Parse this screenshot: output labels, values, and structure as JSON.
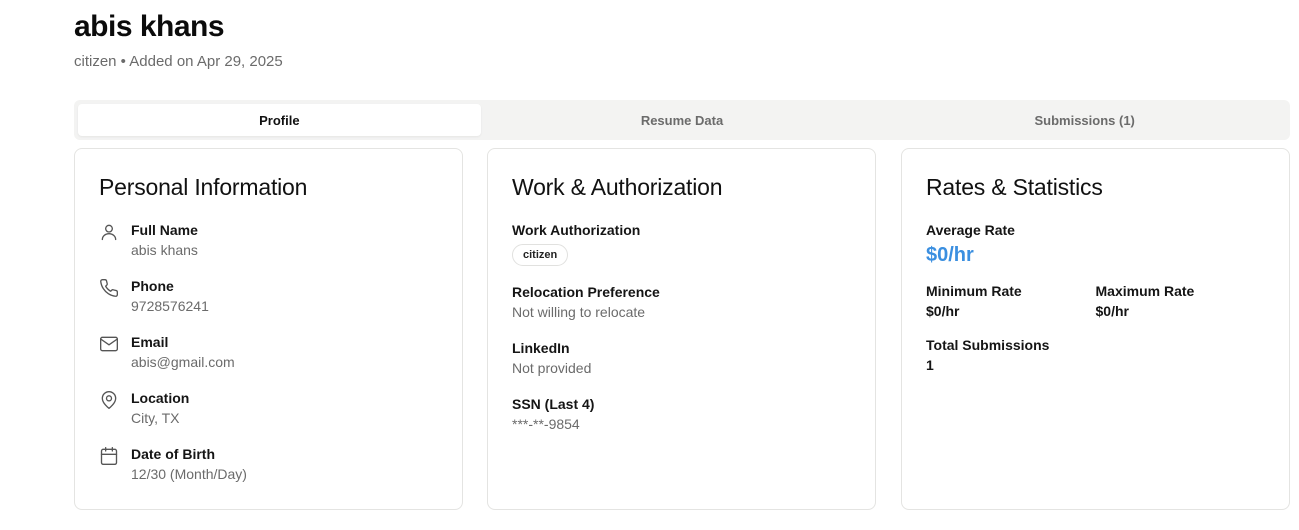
{
  "header": {
    "name": "abis khans",
    "subtitle": "citizen • Added on Apr 29, 2025"
  },
  "tabs": [
    {
      "label": "Profile",
      "active": true
    },
    {
      "label": "Resume Data",
      "active": false
    },
    {
      "label": "Submissions (1)",
      "active": false
    }
  ],
  "personal": {
    "title": "Personal Information",
    "items": [
      {
        "icon": "user-icon",
        "label": "Full Name",
        "value": "abis khans"
      },
      {
        "icon": "phone-icon",
        "label": "Phone",
        "value": "9728576241"
      },
      {
        "icon": "mail-icon",
        "label": "Email",
        "value": "abis@gmail.com"
      },
      {
        "icon": "map-pin-icon",
        "label": "Location",
        "value": "City, TX"
      },
      {
        "icon": "calendar-icon",
        "label": "Date of Birth",
        "value": "12/30 (Month/Day)"
      }
    ]
  },
  "work": {
    "title": "Work & Authorization",
    "work_auth_label": "Work Authorization",
    "work_auth_badge": "citizen",
    "relocation_label": "Relocation Preference",
    "relocation_value": "Not willing to relocate",
    "linkedin_label": "LinkedIn",
    "linkedin_value": "Not provided",
    "ssn_label": "SSN (Last 4)",
    "ssn_value": "***-**-9854"
  },
  "rates": {
    "title": "Rates & Statistics",
    "avg_label": "Average Rate",
    "avg_value": "$0/hr",
    "min_label": "Minimum Rate",
    "min_value": "$0/hr",
    "max_label": "Maximum Rate",
    "max_value": "$0/hr",
    "subs_label": "Total Submissions",
    "subs_value": "1",
    "accent_color": "#3b8fe0"
  }
}
